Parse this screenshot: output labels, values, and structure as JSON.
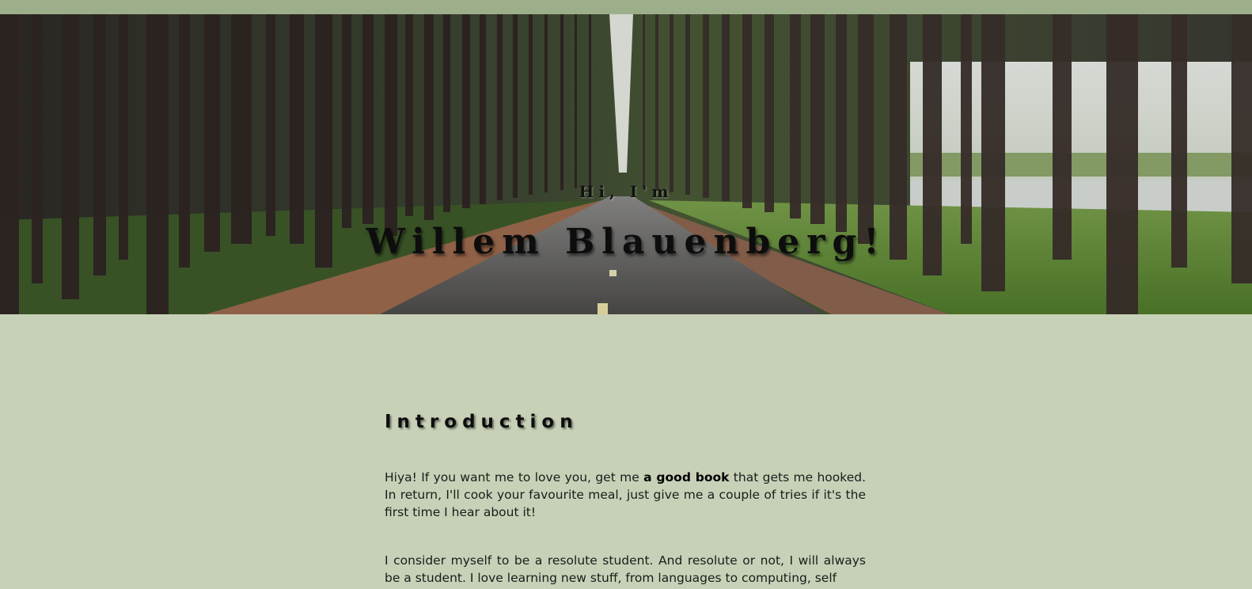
{
  "theme": {
    "background": "#c7d1b7",
    "topbar": "#9daf8a",
    "text": "#1b1b1b"
  },
  "hero": {
    "image": "forest-road-photo",
    "greeting": "Hi, I'm",
    "name": "Willem Blauenberg!"
  },
  "introduction": {
    "title": "Introduction",
    "paragraph1": {
      "before": "Hiya! If you want me to love you, get me ",
      "bold": "a good book",
      "after": " that gets me hooked. In return, I'll cook your favourite meal, just give me a couple of tries if it's the first time I hear about it!"
    },
    "paragraph2": "I consider myself to be a resolute student. And resolute or not, I will always be a student. I love learning new stuff, from languages to computing, self"
  }
}
